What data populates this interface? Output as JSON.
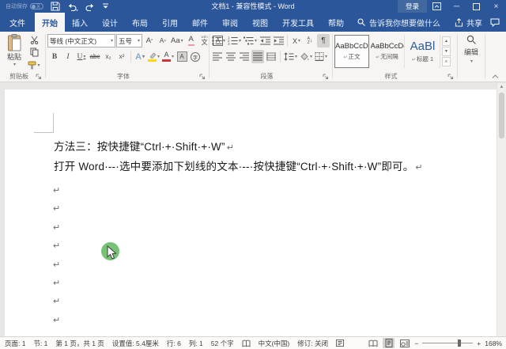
{
  "titlebar": {
    "autosave_label": "自动保存",
    "autosave_state": "关",
    "title": "文档1 - 兼容性模式 - Word",
    "signin_label": "登录"
  },
  "tabs": {
    "file": "文件",
    "items": [
      "开始",
      "插入",
      "设计",
      "布局",
      "引用",
      "邮件",
      "审阅",
      "视图",
      "开发工具",
      "帮助"
    ],
    "search_placeholder": "告诉我你想要做什么",
    "share_label": "共享"
  },
  "ribbon": {
    "clipboard": {
      "paste_label": "粘贴",
      "group_label": "剪贴板"
    },
    "font": {
      "group_label": "字体",
      "font_name": "等线 (中文正文)",
      "font_size": "五号",
      "grow": "A",
      "shrink": "A",
      "case_label": "Aa",
      "clear": "A",
      "pinyin_top": "wén",
      "pinyin_bottom": "文",
      "char_border": "A",
      "bold": "B",
      "italic": "I",
      "underline": "U",
      "strike": "abc",
      "subscript": "x₂",
      "superscript": "x²",
      "effects": "A",
      "shading": "A",
      "color": "A",
      "circle_char": "字"
    },
    "paragraph": {
      "group_label": "段落",
      "asian_layout": "X",
      "sort_label": "排",
      "pilcrow": "¶"
    },
    "styles": {
      "group_label": "样式",
      "items": [
        {
          "preview": "AaBbCcDd",
          "name": "正文"
        },
        {
          "preview": "AaBbCcDd",
          "name": "无间隔"
        },
        {
          "preview": "AaBl",
          "name": "标题 1"
        }
      ]
    },
    "editing": {
      "label": "编辑"
    }
  },
  "document": {
    "line1": "方法三：按快捷键“Ctrl·+·Shift·+·W”",
    "line2": "打开 Word·--·选中要添加下划线的文本·--·按快捷键“Ctrl·+·Shift·+·W”即可。",
    "paragraph_mark": "↵"
  },
  "statusbar": {
    "page": "页面: 1",
    "section": "节: 1",
    "page_of": "第 1 页，共 1 页",
    "setting": "设置值: 5.4厘米",
    "line": "行: 6",
    "column": "列: 1",
    "words": "52 个字",
    "language": "中文(中国)",
    "revision": "修订: 关闭",
    "zoom_minus": "−",
    "zoom_plus": "+",
    "zoom_level": "168%"
  },
  "colors": {
    "accent_blue": "#2b579a",
    "click_indicator_green": "#6fbf6f",
    "font_color_red": "#d13438",
    "highlight_yellow": "#ffd800"
  }
}
